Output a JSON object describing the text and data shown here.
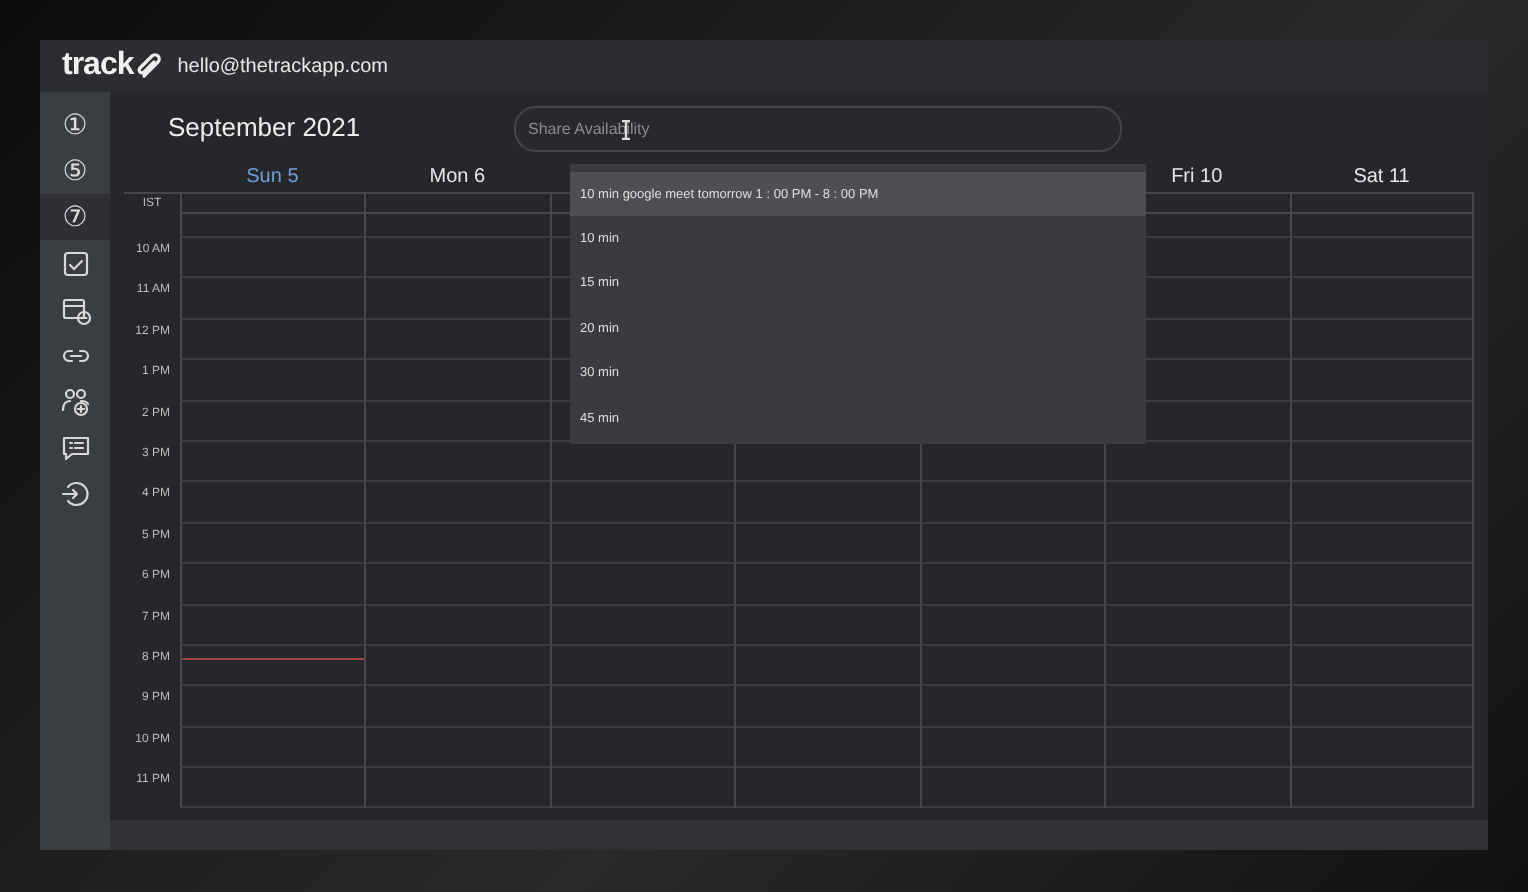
{
  "header": {
    "logo": "track",
    "email": "hello@thetrackapp.com"
  },
  "sidebar": {
    "items": [
      {
        "kind": "number",
        "glyph": "①",
        "selected": false
      },
      {
        "kind": "number",
        "glyph": "⑤",
        "selected": false
      },
      {
        "kind": "number",
        "glyph": "⑦",
        "selected": true
      },
      {
        "kind": "icon",
        "selected": false
      },
      {
        "kind": "icon",
        "selected": false
      },
      {
        "kind": "icon",
        "selected": false
      },
      {
        "kind": "icon",
        "selected": false
      },
      {
        "kind": "icon",
        "selected": false
      },
      {
        "kind": "icon",
        "selected": false
      }
    ]
  },
  "calendar": {
    "title": "September 2021",
    "timezone": "IST",
    "days": [
      {
        "label": "Sun 5",
        "today": true
      },
      {
        "label": "Mon 6",
        "today": false
      },
      {
        "today": false
      },
      {
        "today": false
      },
      {
        "today": false
      },
      {
        "label": "Fri 10",
        "today": false
      },
      {
        "label": "Sat 11",
        "today": false
      }
    ],
    "hours": [
      "10 AM",
      "11 AM",
      "12 PM",
      "1 PM",
      "2 PM",
      "3 PM",
      "4 PM",
      "5 PM",
      "6 PM",
      "7 PM",
      "8 PM",
      "9 PM",
      "10 PM",
      "11 PM"
    ]
  },
  "share_availability": {
    "placeholder": "Share Availability",
    "options": [
      {
        "label": "10 min google meet tomorrow 1 : 00 PM - 8 : 00 PM",
        "selected": true
      },
      {
        "label": "10 min",
        "selected": false
      },
      {
        "label": "15 min",
        "selected": false
      },
      {
        "label": "20 min",
        "selected": false
      },
      {
        "label": "30 min",
        "selected": false
      },
      {
        "label": "45 min",
        "selected": false
      }
    ]
  }
}
